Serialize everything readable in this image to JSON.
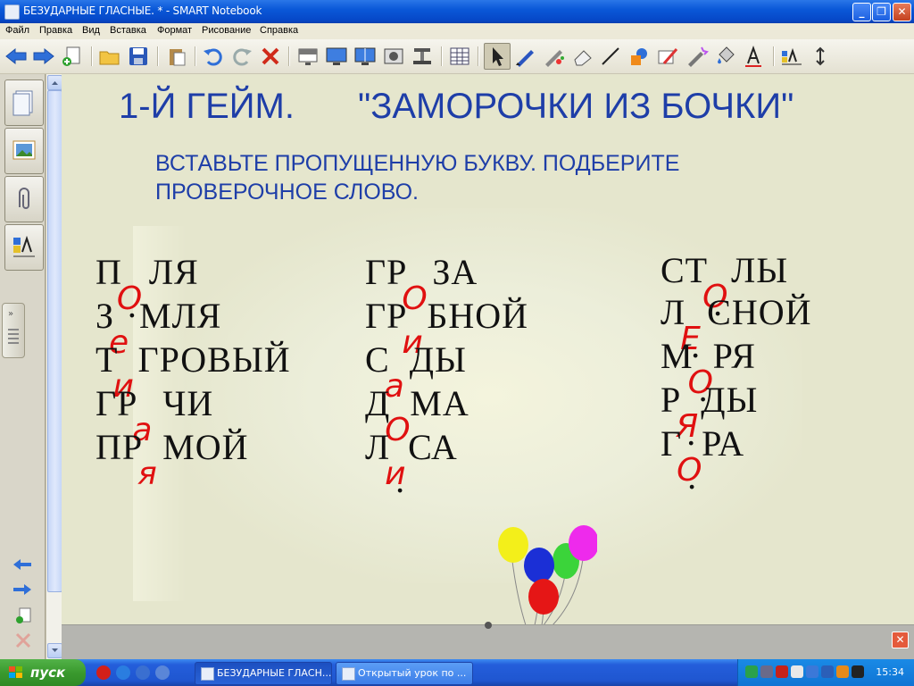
{
  "window": {
    "title": "БЕЗУДАРНЫЕ ГЛАСНЫЕ. * - SMART Notebook"
  },
  "menu": [
    "Файл",
    "Правка",
    "Вид",
    "Вставка",
    "Формат",
    "Рисование",
    "Справка"
  ],
  "toolbar": {
    "icons": [
      "back-arrow-icon",
      "forward-arrow-icon",
      "add-page-icon",
      "open-folder-icon",
      "save-icon",
      "paste-icon",
      "undo-icon",
      "redo-icon",
      "delete-icon",
      "screen-shade-icon",
      "full-screen-icon",
      "dual-page-icon",
      "screen-capture-icon",
      "document-camera-icon",
      "table-icon",
      "select-arrow-icon",
      "pen-icon",
      "creative-pen-icon",
      "eraser-icon",
      "line-icon",
      "shape-icon",
      "magic-pen-icon",
      "fill-icon",
      "text-icon",
      "properties-icon",
      "move-toolbar-icon"
    ]
  },
  "slide": {
    "title_left": "1-Й ГЕЙМ.",
    "title_right": "\"ЗАМОРОЧКИ ИЗ БОЧКИ\"",
    "instruction_line1": "ВСТАВЬТЕ ПРОПУЩЕННУЮ БУКВУ. ПОДБЕРИТЕ",
    "instruction_line2": "ПРОВЕРОЧНОЕ СЛОВО.",
    "columns": [
      [
        {
          "pre": "П",
          "post": "ЛЯ",
          "dot": true
        },
        {
          "pre": "З",
          "post": "МЛЯ",
          "dot": false
        },
        {
          "pre": "Т",
          "post": "ГРОВЫЙ",
          "dot": false
        },
        {
          "pre": "ГР",
          "post": "ЧИ",
          "dot": false
        },
        {
          "pre": "ПР",
          "post": "МОЙ",
          "dot": false
        }
      ],
      [
        {
          "pre": "ГР",
          "post": "ЗА",
          "dot": false
        },
        {
          "pre": "ГР",
          "post": "БНОЙ",
          "dot": false
        },
        {
          "pre": "С",
          "post": "ДЫ",
          "dot": false
        },
        {
          "pre": "Д",
          "post": "МА",
          "dot": false
        },
        {
          "pre": "Л",
          "post": "СА",
          "dot": true
        }
      ],
      [
        {
          "pre": "СТ",
          "post": "ЛЫ",
          "dot": true
        },
        {
          "pre": "Л",
          "post": "СНОЙ",
          "dot": true
        },
        {
          "pre": "М",
          "post": "РЯ",
          "dot": true
        },
        {
          "pre": "Р",
          "post": "ДЫ",
          "dot": true
        },
        {
          "pre": "Г",
          "post": "РА",
          "dot": true
        }
      ]
    ],
    "handwritten": [
      [
        "О",
        "е",
        "и",
        "а",
        "я"
      ],
      [
        "О",
        "и",
        "а",
        "О",
        "и"
      ],
      [
        "О",
        "Е",
        "О",
        "Я",
        "О"
      ]
    ],
    "balloon_colors": [
      "#f3ef1a",
      "#1b2fd6",
      "#3bd43a",
      "#ee2aec",
      "#e51616"
    ]
  },
  "taskbar": {
    "start_label": "пуск",
    "items": [
      "БЕЗУДАРНЫЕ ГЛАСН...",
      "Открытый урок по ..."
    ],
    "clock": "15:34"
  },
  "colors": {
    "heading_blue": "#1e3ea8",
    "ink_red": "#e01010",
    "page_bg": "#e5e6cd"
  }
}
